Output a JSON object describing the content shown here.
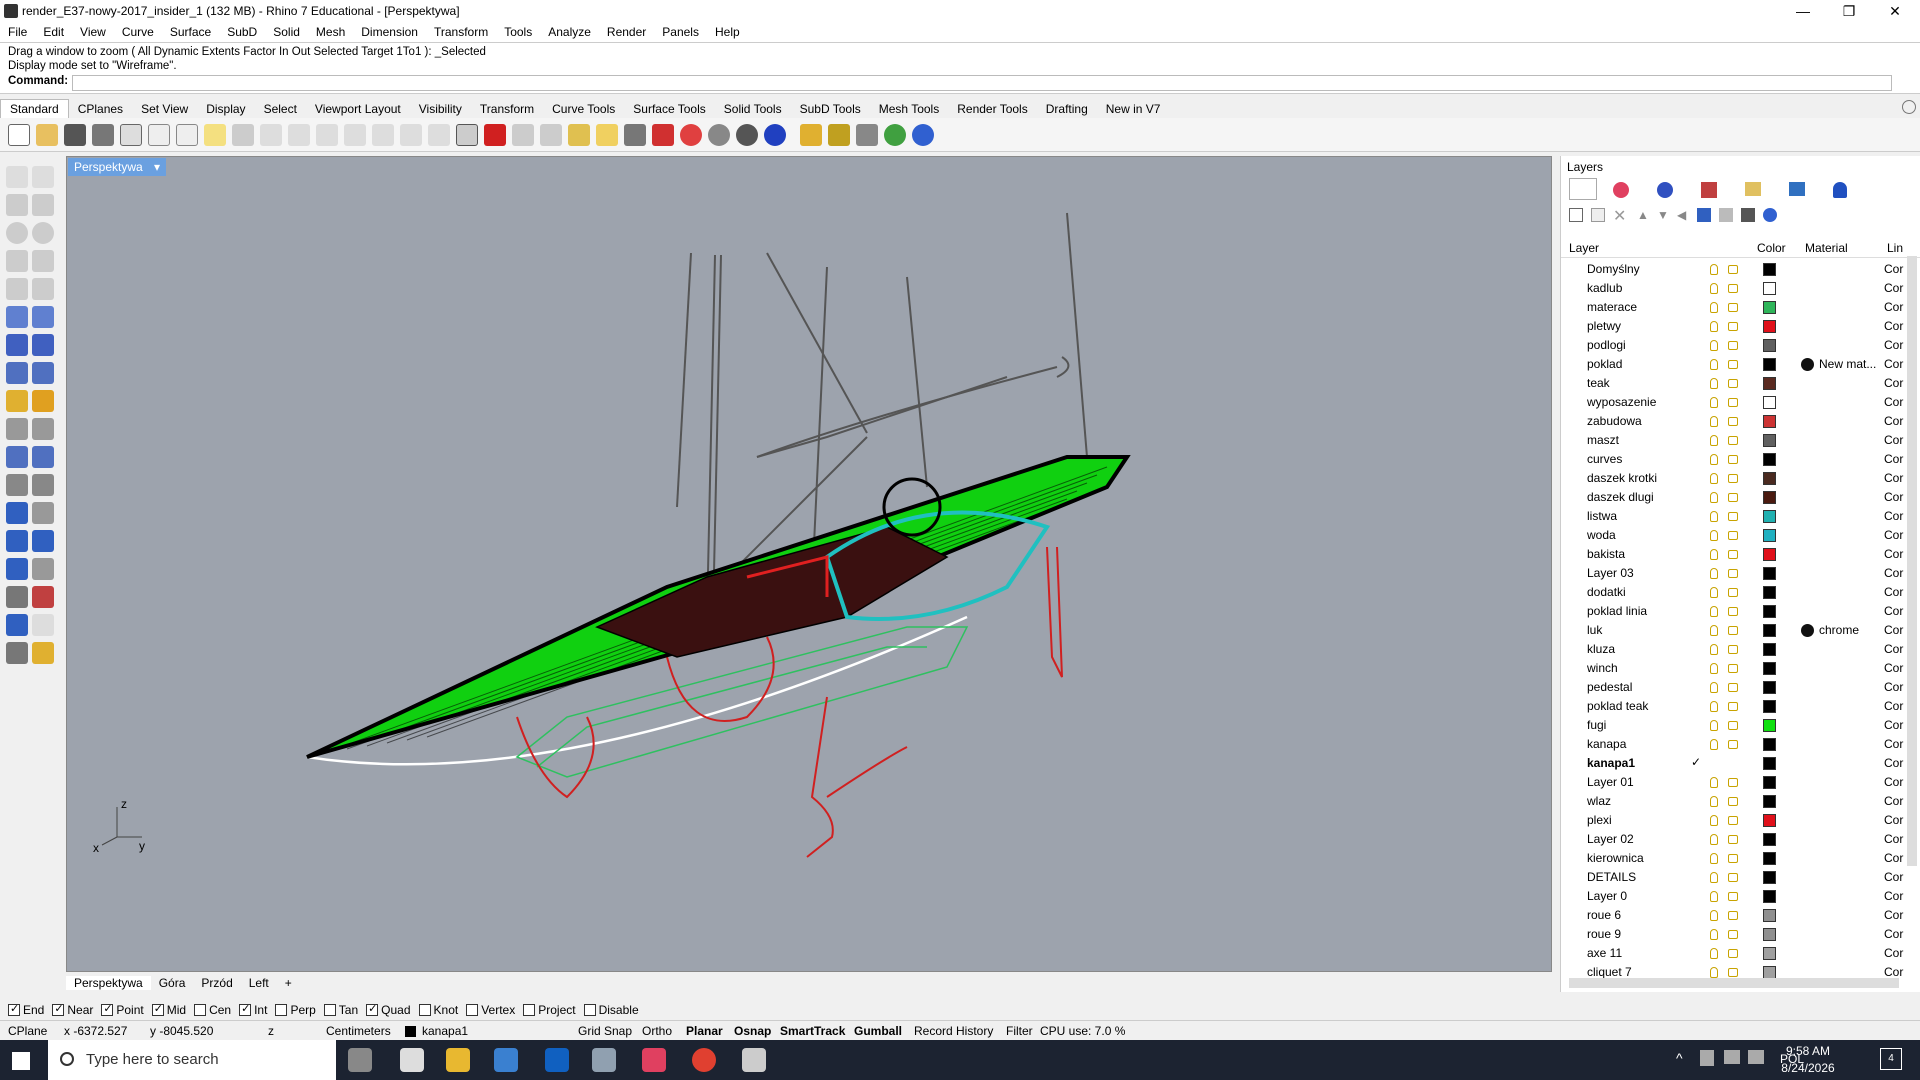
{
  "window": {
    "title": "render_E37-nowy-2017_insider_1 (132 MB) - Rhino 7 Educational - [Perspektywa]"
  },
  "menu": [
    "File",
    "Edit",
    "View",
    "Curve",
    "Surface",
    "SubD",
    "Solid",
    "Mesh",
    "Dimension",
    "Transform",
    "Tools",
    "Analyze",
    "Render",
    "Panels",
    "Help"
  ],
  "command": {
    "history": [
      "Drag a window to zoom ( All  Dynamic  Extents  Factor  In  Out  Selected  Target  1To1 ): _Selected",
      "Display mode set to \"Wireframe\"."
    ],
    "prompt": "Command:",
    "value": ""
  },
  "tabs": [
    "Standard",
    "CPlanes",
    "Set View",
    "Display",
    "Select",
    "Viewport Layout",
    "Visibility",
    "Transform",
    "Curve Tools",
    "Surface Tools",
    "Solid Tools",
    "SubD Tools",
    "Mesh Tools",
    "Render Tools",
    "Drafting",
    "New in V7"
  ],
  "viewport": {
    "title": "Perspektywa",
    "axes": {
      "z": "z",
      "y": "y",
      "x": "x"
    },
    "bottom_tabs": [
      "Perspektywa",
      "Góra",
      "Przód",
      "Left"
    ]
  },
  "layers": {
    "title": "Layers",
    "columns": {
      "layer": "Layer",
      "color": "Color",
      "material": "Material",
      "linetype": "Lin"
    },
    "rows": [
      {
        "name": "Domyślny",
        "color": "#000000",
        "mat": "",
        "ln": "Cor"
      },
      {
        "name": "kadlub",
        "color": "#ffffff",
        "mat": "",
        "ln": "Cor"
      },
      {
        "name": "materace",
        "color": "#2fb55a",
        "mat": "",
        "ln": "Cor"
      },
      {
        "name": "pletwy",
        "color": "#e0101a",
        "mat": "",
        "ln": "Cor"
      },
      {
        "name": "podlogi",
        "color": "#606060",
        "mat": "",
        "ln": "Cor"
      },
      {
        "name": "poklad",
        "color": "#000000",
        "mat": "New mat...",
        "ln": "Cor"
      },
      {
        "name": "teak",
        "color": "#5a2a20",
        "mat": "",
        "ln": "Cor"
      },
      {
        "name": "wyposazenie",
        "color": "#ffffff",
        "mat": "",
        "ln": "Cor"
      },
      {
        "name": "zabudowa",
        "color": "#cc3333",
        "mat": "",
        "ln": "Cor"
      },
      {
        "name": "maszt",
        "color": "#606060",
        "mat": "",
        "ln": "Cor"
      },
      {
        "name": "curves",
        "color": "#000000",
        "mat": "",
        "ln": "Cor"
      },
      {
        "name": "daszek krotki",
        "color": "#4a2a20",
        "mat": "",
        "ln": "Cor"
      },
      {
        "name": "daszek dlugi",
        "color": "#4a1a10",
        "mat": "",
        "ln": "Cor"
      },
      {
        "name": "listwa",
        "color": "#20b0b0",
        "mat": "",
        "ln": "Cor"
      },
      {
        "name": "woda",
        "color": "#20b0c0",
        "mat": "",
        "ln": "Cor"
      },
      {
        "name": "bakista",
        "color": "#e0101a",
        "mat": "",
        "ln": "Cor"
      },
      {
        "name": "Layer 03",
        "color": "#000000",
        "mat": "",
        "ln": "Cor"
      },
      {
        "name": "dodatki",
        "color": "#000000",
        "mat": "",
        "ln": "Cor"
      },
      {
        "name": "poklad linia",
        "color": "#000000",
        "mat": "",
        "ln": "Cor"
      },
      {
        "name": "luk",
        "color": "#000000",
        "mat": "chrome",
        "ln": "Cor"
      },
      {
        "name": "kluza",
        "color": "#000000",
        "mat": "",
        "ln": "Cor"
      },
      {
        "name": "winch",
        "color": "#000000",
        "mat": "",
        "ln": "Cor"
      },
      {
        "name": "pedestal",
        "color": "#000000",
        "mat": "",
        "ln": "Cor"
      },
      {
        "name": "poklad teak",
        "color": "#000000",
        "mat": "",
        "ln": "Cor"
      },
      {
        "name": "fugi",
        "color": "#10e010",
        "mat": "",
        "ln": "Cor"
      },
      {
        "name": "kanapa",
        "color": "#000000",
        "mat": "",
        "ln": "Cor"
      },
      {
        "name": "kanapa1",
        "color": "#000000",
        "mat": "",
        "ln": "Cor",
        "current": true
      },
      {
        "name": "Layer 01",
        "color": "#000000",
        "mat": "",
        "ln": "Cor"
      },
      {
        "name": "wlaz",
        "color": "#000000",
        "mat": "",
        "ln": "Cor"
      },
      {
        "name": "plexi",
        "color": "#e0101a",
        "mat": "",
        "ln": "Cor"
      },
      {
        "name": "Layer 02",
        "color": "#000000",
        "mat": "",
        "ln": "Cor"
      },
      {
        "name": "kierownica",
        "color": "#000000",
        "mat": "",
        "ln": "Cor"
      },
      {
        "name": "DETAILS",
        "color": "#000000",
        "mat": "",
        "ln": "Cor"
      },
      {
        "name": "Layer 0",
        "color": "#000000",
        "mat": "",
        "ln": "Cor"
      },
      {
        "name": "roue 6",
        "color": "#909090",
        "mat": "",
        "ln": "Cor"
      },
      {
        "name": "roue 9",
        "color": "#909090",
        "mat": "",
        "ln": "Cor"
      },
      {
        "name": "axe 11",
        "color": "#a0a0a0",
        "mat": "",
        "ln": "Cor"
      },
      {
        "name": "cliquet 7",
        "color": "#a0a0a0",
        "mat": "",
        "ln": "Cor"
      }
    ]
  },
  "osnap": [
    {
      "label": "End",
      "on": true
    },
    {
      "label": "Near",
      "on": true
    },
    {
      "label": "Point",
      "on": true
    },
    {
      "label": "Mid",
      "on": true
    },
    {
      "label": "Cen",
      "on": false
    },
    {
      "label": "Int",
      "on": true
    },
    {
      "label": "Perp",
      "on": false
    },
    {
      "label": "Tan",
      "on": false
    },
    {
      "label": "Quad",
      "on": true
    },
    {
      "label": "Knot",
      "on": false
    },
    {
      "label": "Vertex",
      "on": false
    },
    {
      "label": "Project",
      "on": false
    },
    {
      "label": "Disable",
      "on": false
    }
  ],
  "status": {
    "cplane": "CPlane",
    "x": "x -6372.527",
    "y": "y -8045.520",
    "z": "z",
    "units": "Centimeters",
    "layer": "kanapa1",
    "grid_snap": "Grid Snap",
    "ortho": "Ortho",
    "planar": "Planar",
    "osnap": "Osnap",
    "smarttrack": "SmartTrack",
    "gumball": "Gumball",
    "record": "Record History",
    "filter": "Filter",
    "cpu": "CPU use: 7.0 %"
  },
  "taskbar": {
    "search": "Type here to search",
    "lang": "POL",
    "time": "9:58 AM",
    "date": "8/24/2026",
    "notif": "4"
  }
}
